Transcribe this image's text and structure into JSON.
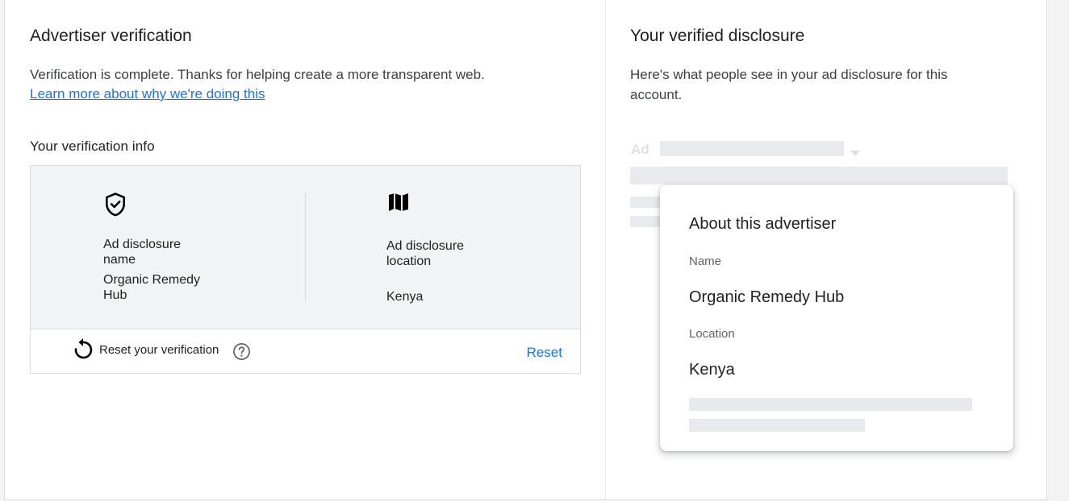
{
  "left": {
    "title": "Advertiser verification",
    "status_text": "Verification is complete. Thanks for helping create a more transparent web.",
    "learn_more_link": "Learn more about why we're doing this",
    "info_heading": "Your verification info",
    "name_label": "Ad disclosure name",
    "name_value": "Organic Remedy Hub",
    "location_label": "Ad disclosure location",
    "location_value": "Kenya",
    "reset_label": "Reset your verification",
    "reset_button": "Reset",
    "icons": {
      "name": "shield-check-icon",
      "location": "map-icon",
      "reset": "reset-icon",
      "help": "help-icon"
    }
  },
  "right": {
    "title": "Your verified disclosure",
    "description": "Here's what people see in your ad disclosure for this account.",
    "ad_badge": "Ad",
    "popup": {
      "title": "About this advertiser",
      "name_label": "Name",
      "name_value": "Organic Remedy Hub",
      "location_label": "Location",
      "location_value": "Kenya"
    }
  },
  "colors": {
    "accent": "#1a73e8",
    "panel_bg": "#f1f3f4",
    "placeholder": "#e8eaed"
  }
}
